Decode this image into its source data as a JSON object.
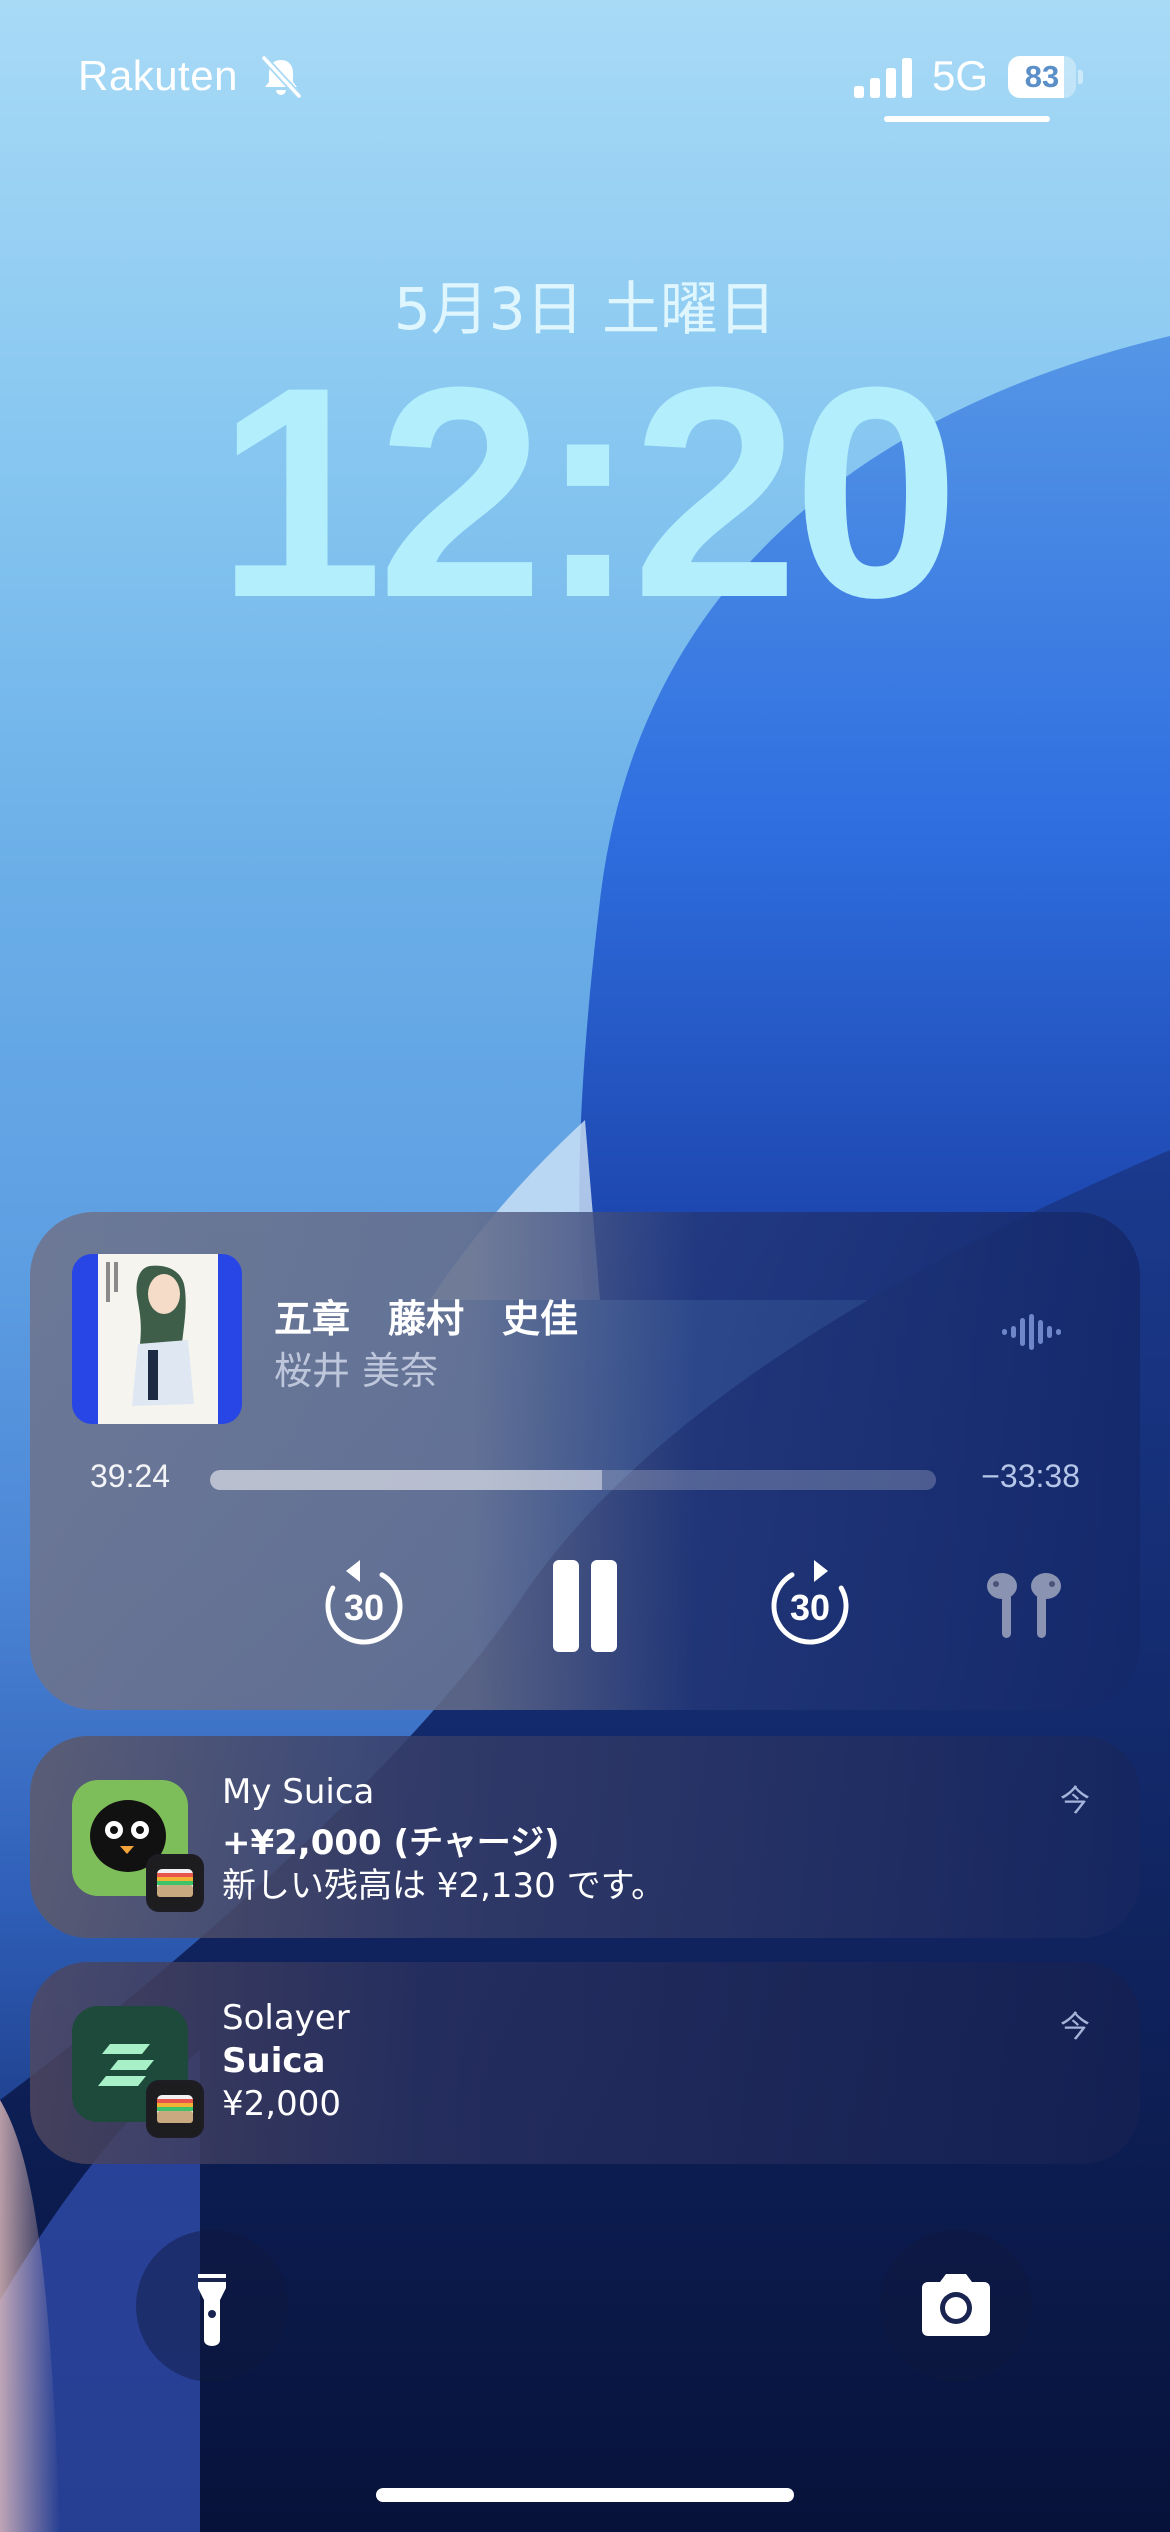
{
  "status_bar": {
    "carrier": "Rakuten",
    "network": "5G",
    "battery_percent": "83",
    "battery_level": 0.83,
    "signal_bars": 4,
    "icons": [
      "bell-slash-icon",
      "signal-icon",
      "battery-icon"
    ]
  },
  "lock_screen": {
    "date": "5月3日 土曜日",
    "time": "12:20"
  },
  "now_playing": {
    "title": "五章　藤村　史佳",
    "artist": "桜井 美奈",
    "elapsed": "39:24",
    "remaining": "−33:38",
    "progress": 0.54,
    "skip_back_seconds": "30",
    "skip_forward_seconds": "30",
    "icons": [
      "waveform-icon",
      "skip-back-30-icon",
      "pause-icon",
      "skip-forward-30-icon",
      "airpods-icon"
    ]
  },
  "notifications": [
    {
      "app": "wallet",
      "title": "My Suica",
      "subtitle": "+¥2,000 (チャージ)",
      "body": "新しい残高は ¥2,130 です。",
      "time": "今"
    },
    {
      "app": "wallet",
      "title": "Solayer",
      "subtitle": "Suica",
      "body": "¥2,000",
      "time": "今"
    }
  ],
  "bottom_controls": {
    "icons": [
      "flashlight-icon",
      "camera-icon"
    ]
  },
  "colors": {
    "clock": "#b3eefc",
    "suica_icon_bg": "#7dbd5a",
    "solayer_icon_bg": "#1d4a3a",
    "artwork_bg": "#2846e6"
  }
}
